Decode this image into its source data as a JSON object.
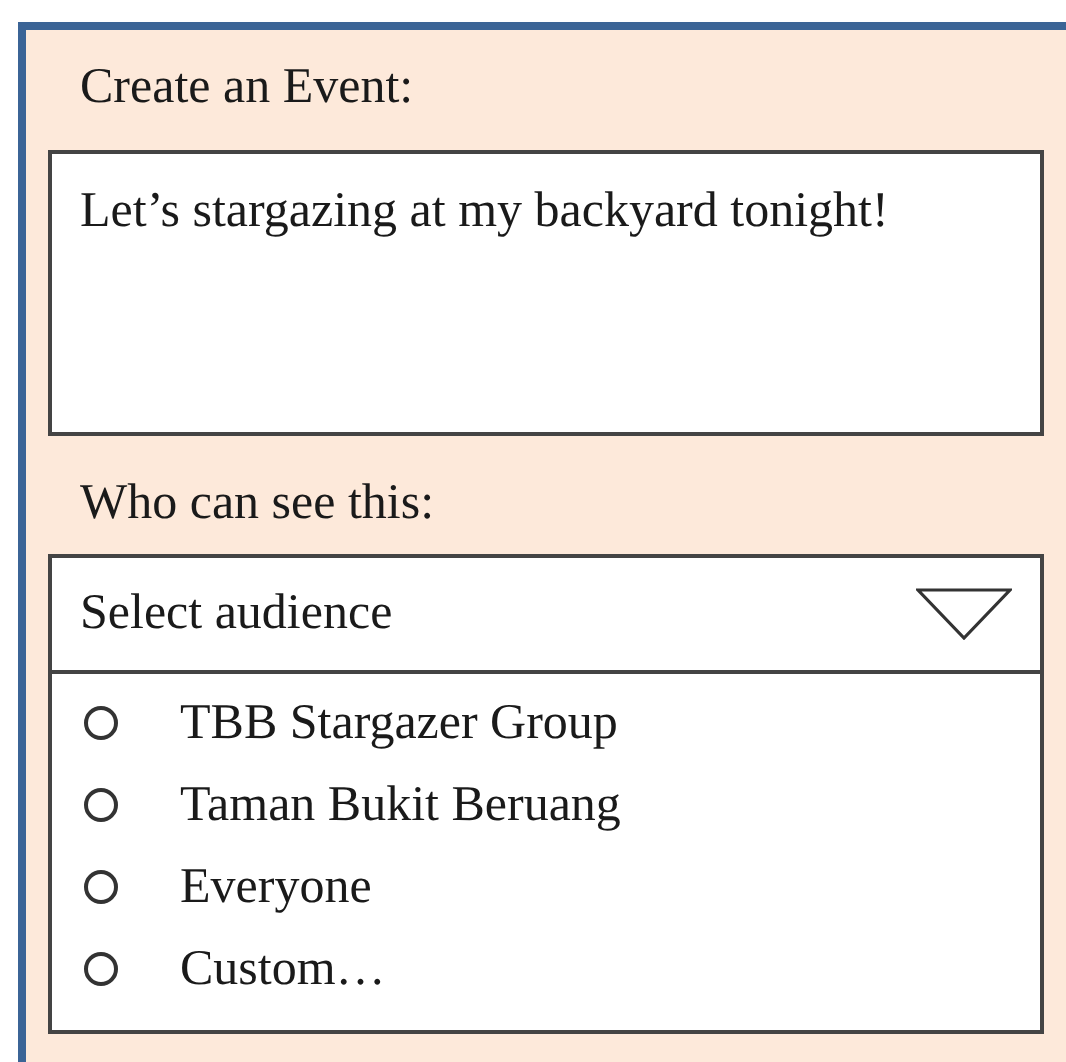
{
  "form": {
    "title": "Create an Event:",
    "event_text": "Let’s stargazing at my backyard tonight!",
    "audience_label": "Who can see this:",
    "audience_select": {
      "placeholder": "Select audience",
      "expanded": true
    },
    "options": [
      {
        "label": "TBB Stargazer Group",
        "selected": false
      },
      {
        "label": "Taman Bukit Beruang",
        "selected": false
      },
      {
        "label": "Everyone",
        "selected": false
      },
      {
        "label": "Custom…",
        "selected": false
      }
    ]
  }
}
